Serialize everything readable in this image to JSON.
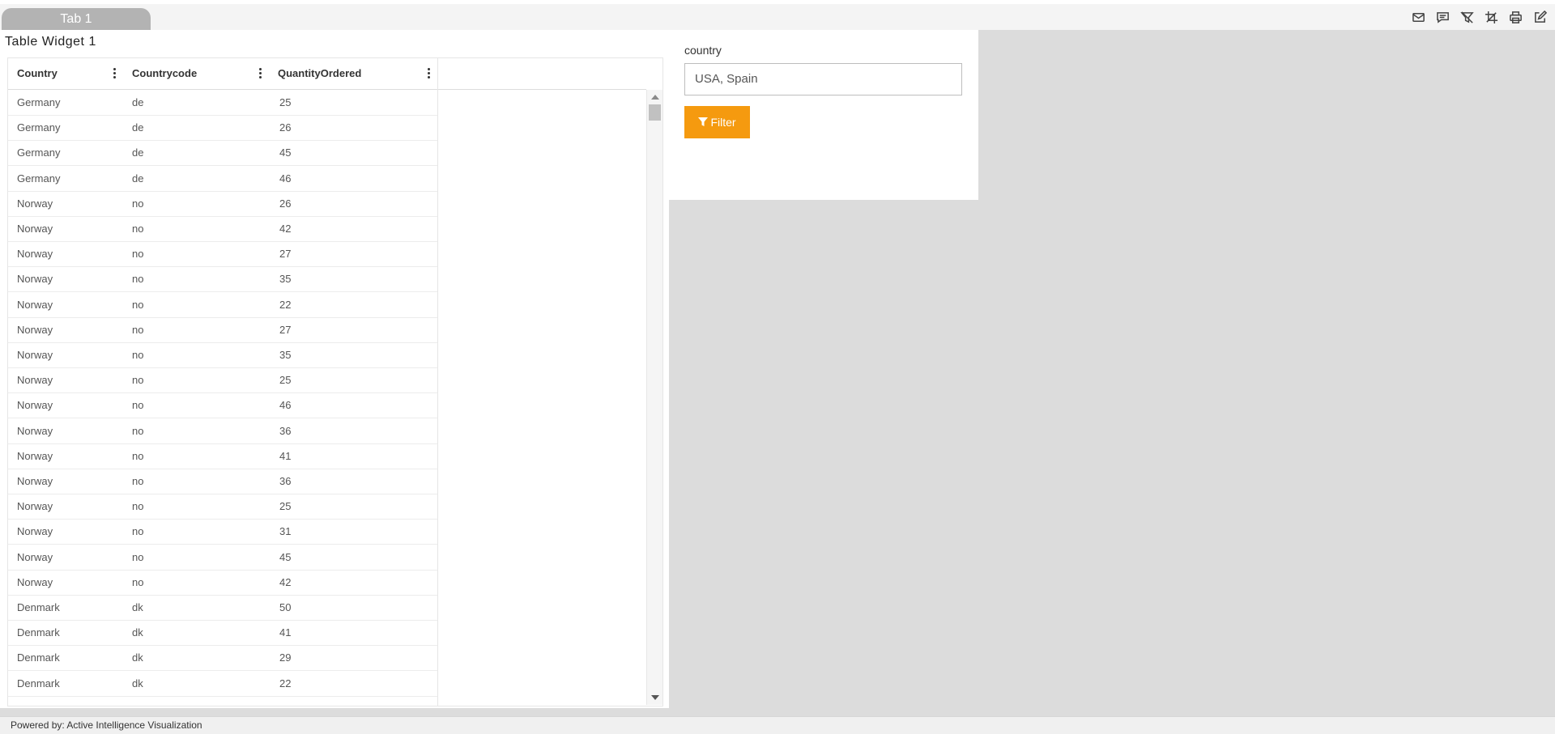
{
  "tabs": [
    {
      "label": "Tab 1"
    }
  ],
  "toolbar": {
    "icons": [
      "mail-icon",
      "comment-icon",
      "clear-filter-icon",
      "crop-icon",
      "print-icon",
      "edit-icon"
    ]
  },
  "table_widget": {
    "title": "Table Widget 1",
    "columns": [
      "Country",
      "Countrycode",
      "QuantityOrdered"
    ],
    "rows": [
      [
        "Germany",
        "de",
        "25"
      ],
      [
        "Germany",
        "de",
        "26"
      ],
      [
        "Germany",
        "de",
        "45"
      ],
      [
        "Germany",
        "de",
        "46"
      ],
      [
        "Norway",
        "no",
        "26"
      ],
      [
        "Norway",
        "no",
        "42"
      ],
      [
        "Norway",
        "no",
        "27"
      ],
      [
        "Norway",
        "no",
        "35"
      ],
      [
        "Norway",
        "no",
        "22"
      ],
      [
        "Norway",
        "no",
        "27"
      ],
      [
        "Norway",
        "no",
        "35"
      ],
      [
        "Norway",
        "no",
        "25"
      ],
      [
        "Norway",
        "no",
        "46"
      ],
      [
        "Norway",
        "no",
        "36"
      ],
      [
        "Norway",
        "no",
        "41"
      ],
      [
        "Norway",
        "no",
        "36"
      ],
      [
        "Norway",
        "no",
        "25"
      ],
      [
        "Norway",
        "no",
        "31"
      ],
      [
        "Norway",
        "no",
        "45"
      ],
      [
        "Norway",
        "no",
        "42"
      ],
      [
        "Denmark",
        "dk",
        "50"
      ],
      [
        "Denmark",
        "dk",
        "41"
      ],
      [
        "Denmark",
        "dk",
        "29"
      ],
      [
        "Denmark",
        "dk",
        "22"
      ]
    ]
  },
  "filter_widget": {
    "label": "country",
    "value": "USA, Spain",
    "button_label": "Filter"
  },
  "footer": {
    "text": "Powered by: Active Intelligence Visualization"
  },
  "colors": {
    "accent": "#f59a0f",
    "canvas": "#dcdcdc",
    "tab": "#b3b3b3"
  }
}
